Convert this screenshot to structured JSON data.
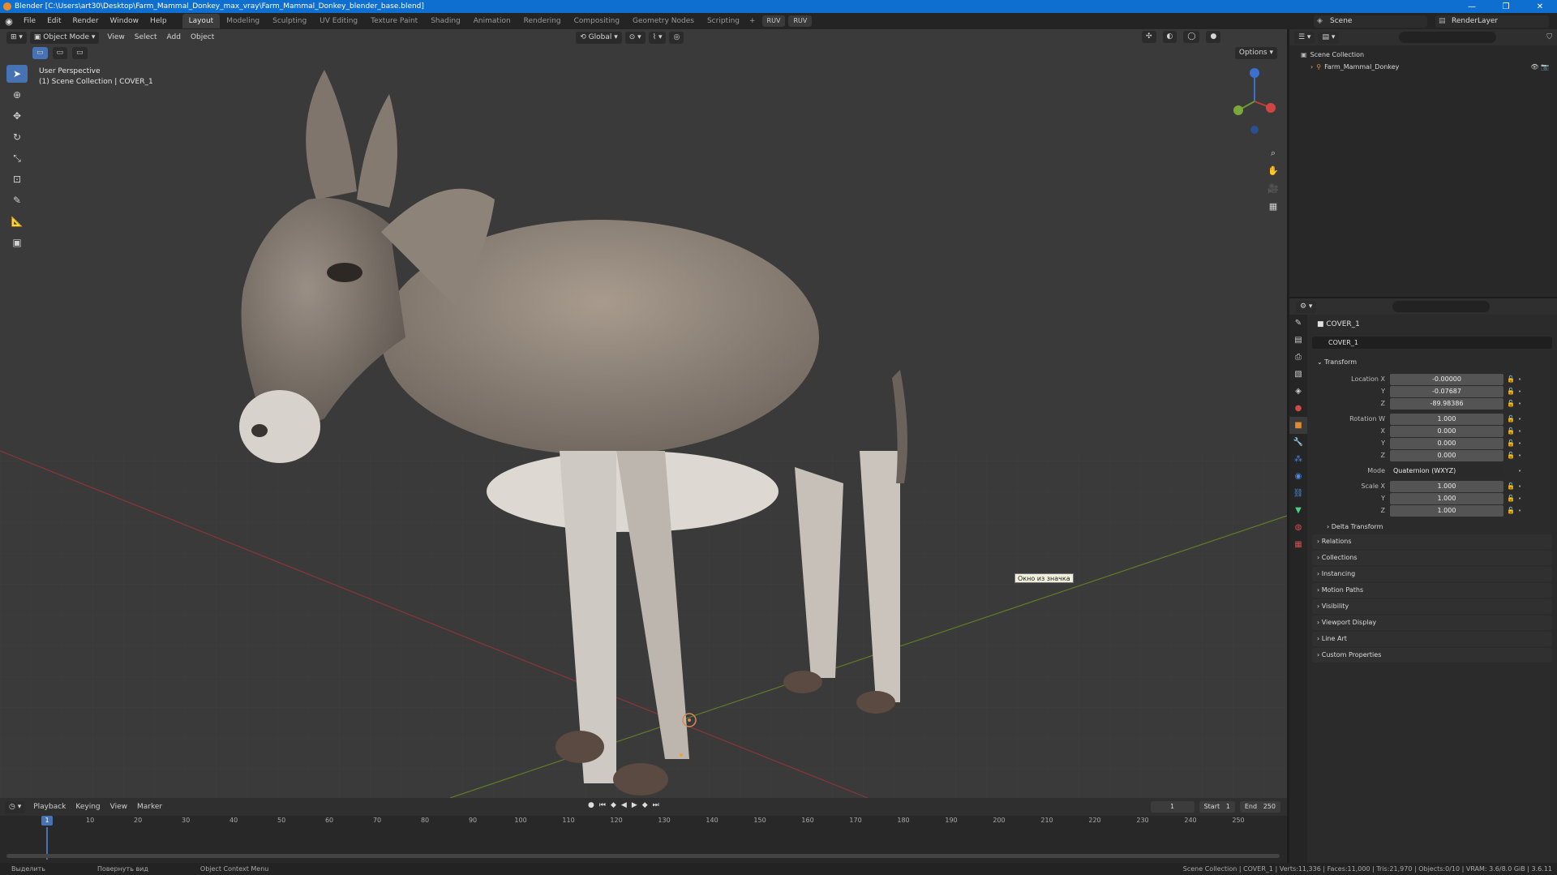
{
  "titlebar": {
    "title": "Blender [C:\\Users\\art30\\Desktop\\Farm_Mammal_Donkey_max_vray\\Farm_Mammal_Donkey_blender_base.blend]",
    "minimize": "—",
    "maximize": "❐",
    "close": "✕"
  },
  "menubar": {
    "items": [
      "File",
      "Edit",
      "Render",
      "Window",
      "Help"
    ],
    "workspaces": [
      "Layout",
      "Modeling",
      "Sculpting",
      "UV Editing",
      "Texture Paint",
      "Shading",
      "Animation",
      "Rendering",
      "Compositing",
      "Geometry Nodes",
      "Scripting"
    ],
    "active_workspace": "Layout",
    "plus": "+",
    "ruv1": "RUV",
    "ruv2": "RUV",
    "scene": "Scene",
    "view_layer": "RenderLayer"
  },
  "viewport": {
    "mode": "Object Mode",
    "menus": [
      "View",
      "Select",
      "Add",
      "Object"
    ],
    "transform_orientation": "Global",
    "options": "Options",
    "perspective_label": "User Perspective",
    "collection_label": "(1) Scene Collection | COVER_1",
    "tooltip": "Окно из значка",
    "accent": "#4772b3",
    "axis_x_color": "#a33a3a",
    "axis_y_color": "#6a8c2a"
  },
  "timeline": {
    "menus": [
      "Playback",
      "Keying",
      "View",
      "Marker"
    ],
    "current_frame": "1",
    "start_label": "Start",
    "start": "1",
    "end_label": "End",
    "end": "250",
    "ticks": [
      "1",
      "10",
      "20",
      "30",
      "40",
      "50",
      "60",
      "70",
      "80",
      "90",
      "100",
      "110",
      "120",
      "130",
      "140",
      "150",
      "160",
      "170",
      "180",
      "190",
      "200",
      "210",
      "220",
      "230",
      "240",
      "250"
    ]
  },
  "statusbar": {
    "select": "Выделить",
    "rotate": "Повернуть вид",
    "context": "Object Context Menu",
    "stats": "Scene Collection | COVER_1 | Verts:11,336 | Faces:11,000 | Tris:21,970 | Objects:0/10 | VRAM: 3.6/8.0 GiB | 3.6.11"
  },
  "outliner": {
    "root": "Scene Collection",
    "object": "Farm_Mammal_Donkey"
  },
  "properties": {
    "object_name": "COVER_1",
    "object_field": "COVER_1",
    "transform_label": "Transform",
    "location_label": "Location X",
    "location": [
      "-0.00000",
      "-0.07687",
      "-89.98386"
    ],
    "rotation_label": "Rotation W",
    "rotation": [
      "1.000",
      "0.000",
      "0.000",
      "0.000"
    ],
    "mode_label": "Mode",
    "mode": "Quaternion (WXYZ)",
    "scale_label": "Scale X",
    "scale": [
      "1.000",
      "1.000",
      "1.000"
    ],
    "y_label": "Y",
    "z_label": "Z",
    "x_label": "X",
    "panels": [
      "Delta Transform",
      "Relations",
      "Collections",
      "Instancing",
      "Motion Paths",
      "Visibility",
      "Viewport Display",
      "Line Art",
      "Custom Properties"
    ]
  }
}
